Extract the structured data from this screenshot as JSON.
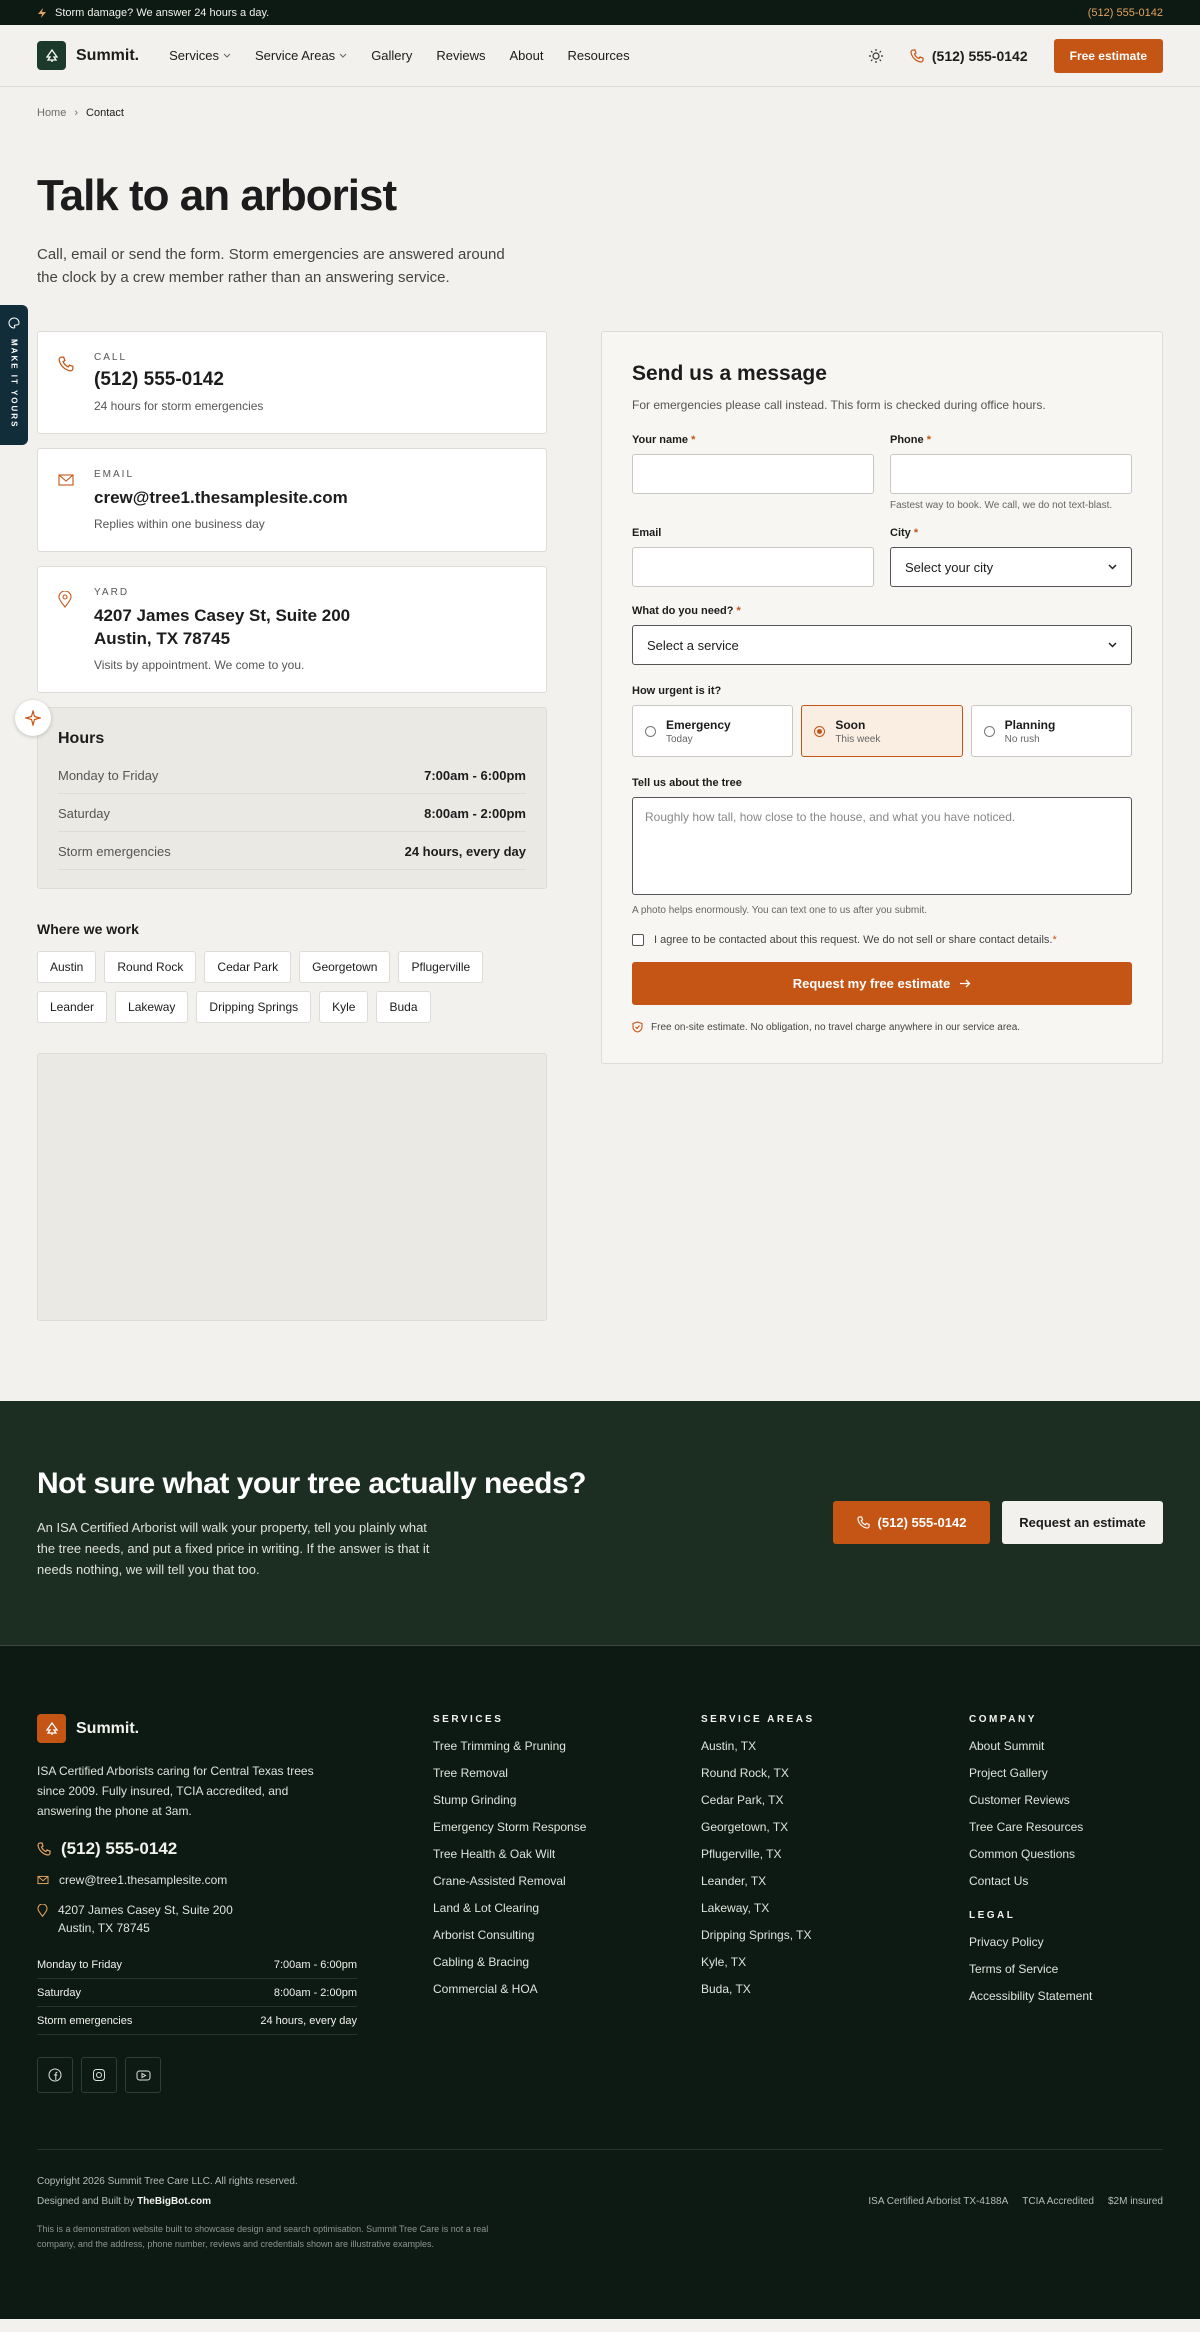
{
  "topbar": {
    "notice": "Storm damage? We answer 24 hours a day.",
    "phone": "(512) 555-0142"
  },
  "nav": {
    "brand": "Summit.",
    "items": [
      "Services",
      "Service Areas",
      "Gallery",
      "Reviews",
      "About",
      "Resources"
    ],
    "phone": "(512) 555-0142",
    "cta": "Free estimate"
  },
  "breadcrumb": {
    "home": "Home",
    "current": "Contact"
  },
  "hero": {
    "title": "Talk to an arborist",
    "subtitle": "Call, email or send the form. Storm emergencies are answered around the clock by a crew member rather than an answering service."
  },
  "contact": {
    "call": {
      "label": "CALL",
      "value": "(512) 555-0142",
      "sub": "24 hours for storm emergencies"
    },
    "email": {
      "label": "EMAIL",
      "value": "crew@tree1.thesamplesite.com",
      "sub": "Replies within one business day"
    },
    "yard": {
      "label": "YARD",
      "line1": "4207 James Casey St, Suite 200",
      "line2": "Austin, TX 78745",
      "sub": "Visits by appointment. We come to you."
    }
  },
  "hours": {
    "title": "Hours",
    "rows": [
      {
        "day": "Monday to Friday",
        "time": "7:00am - 6:00pm"
      },
      {
        "day": "Saturday",
        "time": "8:00am - 2:00pm"
      },
      {
        "day": "Storm emergencies",
        "time": "24 hours, every day"
      }
    ]
  },
  "where": {
    "title": "Where we work",
    "cities": [
      "Austin",
      "Round Rock",
      "Cedar Park",
      "Georgetown",
      "Pflugerville",
      "Leander",
      "Lakeway",
      "Dripping Springs",
      "Kyle",
      "Buda"
    ]
  },
  "form": {
    "title": "Send us a message",
    "intro": "For emergencies please call instead. This form is checked during office hours.",
    "name_label": "Your name",
    "phone_label": "Phone",
    "phone_hint": "Fastest way to book. We call, we do not text-blast.",
    "email_label": "Email",
    "city_label": "City",
    "city_select": "Select your city",
    "need_label": "What do you need?",
    "need_select": "Select a service",
    "urgency_label": "How urgent is it?",
    "urgency": [
      {
        "title": "Emergency",
        "sub": "Today"
      },
      {
        "title": "Soon",
        "sub": "This week"
      },
      {
        "title": "Planning",
        "sub": "No rush"
      }
    ],
    "tree_label": "Tell us about the tree",
    "tree_placeholder": "Roughly how tall, how close to the house, and what you have noticed.",
    "tree_hint": "A photo helps enormously. You can text one to us after you submit.",
    "consent": "I agree to be contacted about this request. We do not sell or share contact details.",
    "submit": "Request my free estimate",
    "guarantee": "Free on-site estimate. No obligation, no travel charge anywhere in our service area.",
    "required_mark": "*"
  },
  "cta": {
    "title": "Not sure what your tree actually needs?",
    "text": "An ISA Certified Arborist will walk your property, tell you plainly what the tree needs, and put a fixed price in writing. If the answer is that it needs nothing, we will tell you that too.",
    "phone": "(512) 555-0142",
    "button": "Request an estimate"
  },
  "footer": {
    "brand": "Summit.",
    "desc": "ISA Certified Arborists caring for Central Texas trees since 2009. Fully insured, TCIA accredited, and answering the phone at 3am.",
    "phone": "(512) 555-0142",
    "email": "crew@tree1.thesamplesite.com",
    "address1": "4207 James Casey St, Suite 200",
    "address2": "Austin, TX 78745",
    "hours": [
      {
        "day": "Monday to Friday",
        "time": "7:00am - 6:00pm"
      },
      {
        "day": "Saturday",
        "time": "8:00am - 2:00pm"
      },
      {
        "day": "Storm emergencies",
        "time": "24 hours, every day"
      }
    ],
    "services_title": "SERVICES",
    "services": [
      "Tree Trimming & Pruning",
      "Tree Removal",
      "Stump Grinding",
      "Emergency Storm Response",
      "Tree Health & Oak Wilt",
      "Crane-Assisted Removal",
      "Land & Lot Clearing",
      "Arborist Consulting",
      "Cabling & Bracing",
      "Commercial & HOA"
    ],
    "areas_title": "SERVICE AREAS",
    "areas": [
      "Austin, TX",
      "Round Rock, TX",
      "Cedar Park, TX",
      "Georgetown, TX",
      "Pflugerville, TX",
      "Leander, TX",
      "Lakeway, TX",
      "Dripping Springs, TX",
      "Kyle, TX",
      "Buda, TX"
    ],
    "company_title": "COMPANY",
    "company": [
      "About Summit",
      "Project Gallery",
      "Customer Reviews",
      "Tree Care Resources",
      "Common Questions",
      "Contact Us"
    ],
    "legal_title": "LEGAL",
    "legal": [
      "Privacy Policy",
      "Terms of Service",
      "Accessibility Statement"
    ],
    "copyright": "Copyright 2026 Summit Tree Care LLC. All rights reserved.",
    "built_prefix": "Designed and Built by",
    "built_by": "TheBigBot.com",
    "badges": [
      "ISA Certified Arborist TX-4188A",
      "TCIA Accredited",
      "$2M insured"
    ],
    "disclaimer": "This is a demonstration website built to showcase design and search optimisation. Summit Tree Care is not a real company, and the address, phone number, reviews and credentials shown are illustrative examples."
  },
  "side_tab": {
    "label": "MAKE IT YOURS"
  },
  "colors": {
    "accent": "#c55514",
    "dark": "#0d1a14",
    "cta_bg": "#1c2d22",
    "bg": "#f2f1ed"
  },
  "icons": [
    "bolt-icon",
    "tree-icon",
    "chevron-down-icon",
    "sun-icon",
    "phone-icon",
    "mail-icon",
    "map-pin-icon",
    "arrow-right-icon",
    "shield-icon",
    "facebook-icon",
    "instagram-icon",
    "youtube-icon",
    "palette-icon",
    "sparkle-icon"
  ]
}
